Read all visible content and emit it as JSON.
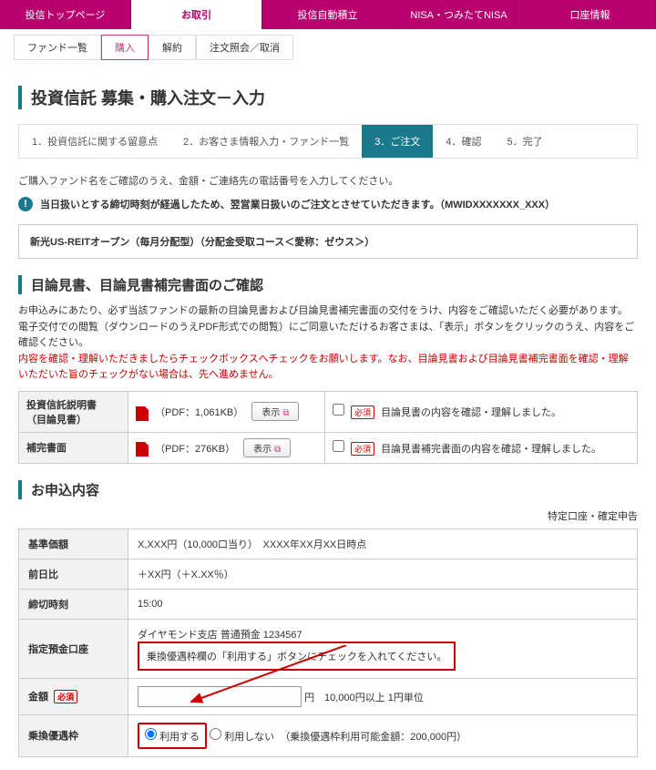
{
  "topnav": {
    "items": [
      "投信トップページ",
      "お取引",
      "投信自動積立",
      "NISA・つみたてNISA",
      "口座情報"
    ],
    "activeIndex": 1
  },
  "subnav": {
    "items": [
      "ファンド一覧",
      "購入",
      "解約",
      "注文照会／取消"
    ],
    "activeIndex": 1
  },
  "page_title": "投資信託 募集・購入注文－入力",
  "steps": {
    "items": [
      "1．投資信託に関する留意点",
      "2．お客さま情報入力・ファンド一覧",
      "3．ご注文",
      "4．確認",
      "5．完了"
    ],
    "activeIndex": 2
  },
  "lead": "ご購入ファンド名をご確認のうえ、金額・ご連絡先の電話番号を入力してください。",
  "notice": "当日扱いとする締切時刻が経過したため、翌営業日扱いのご注文とさせていただきます。（MWIDXXXXXXX_XXX）",
  "fund_name": "新光US-REITオープン（毎月分配型）（分配金受取コース＜愛称：ゼウス＞）",
  "section_docs_title": "目論見書、目論見書補完書面のご確認",
  "docs_desc_1": "お申込みにあたり、必ず当該ファンドの最新の目論見書および目論見書補完書面の交付をうけ、内容をご確認いただく必要があります。",
  "docs_desc_2": "電子交付での閲覧（ダウンロードのうえPDF形式での閲覧）にご同意いただけるお客さまは、「表示」ボタンをクリックのうえ、内容をご確認ください。",
  "docs_desc_3": "内容を確認・理解いただきましたらチェックボックスへチェックをお願いします。なお、目論見書および目論見書補完書面を確認・理解いただいた旨のチェックがない場合は、先へ進めません。",
  "doc_rows": [
    {
      "label": "投資信託説明書\n（目論見書）",
      "size": "（PDF：1,061KB）",
      "btn": "表示",
      "confirm": "目論見書の内容を確認・理解しました。"
    },
    {
      "label": "補完書面",
      "size": "（PDF：276KB）",
      "btn": "表示",
      "confirm": "目論見書補完書面の内容を確認・理解しました。"
    }
  ],
  "section_apply_title": "お申込内容",
  "account_type_note": "特定口座・確定申告",
  "apply": {
    "base_price": {
      "label": "基準価額",
      "value": "X,XXX円（10,000口当り）　XXXX年XX月XX日時点"
    },
    "prev_diff": {
      "label": "前日比",
      "value": "＋XX円（＋X.XX％）"
    },
    "cutoff": {
      "label": "締切時刻",
      "value": "15:00"
    },
    "account": {
      "label": "指定預金口座",
      "value": "ダイヤモンド支店 普通預金 1234567"
    },
    "callout": "乗換優遇枠欄の「利用する」ボタンにチェックを入れてください。",
    "amount": {
      "label": "金額",
      "unit": "円　10,000円以上 1円単位",
      "req": "必須"
    },
    "switch": {
      "label": "乗換優遇枠",
      "opt_use": "利用する",
      "opt_not": "利用しない",
      "note": "（乗換優遇枠利用可能金額：200,000円）"
    }
  }
}
